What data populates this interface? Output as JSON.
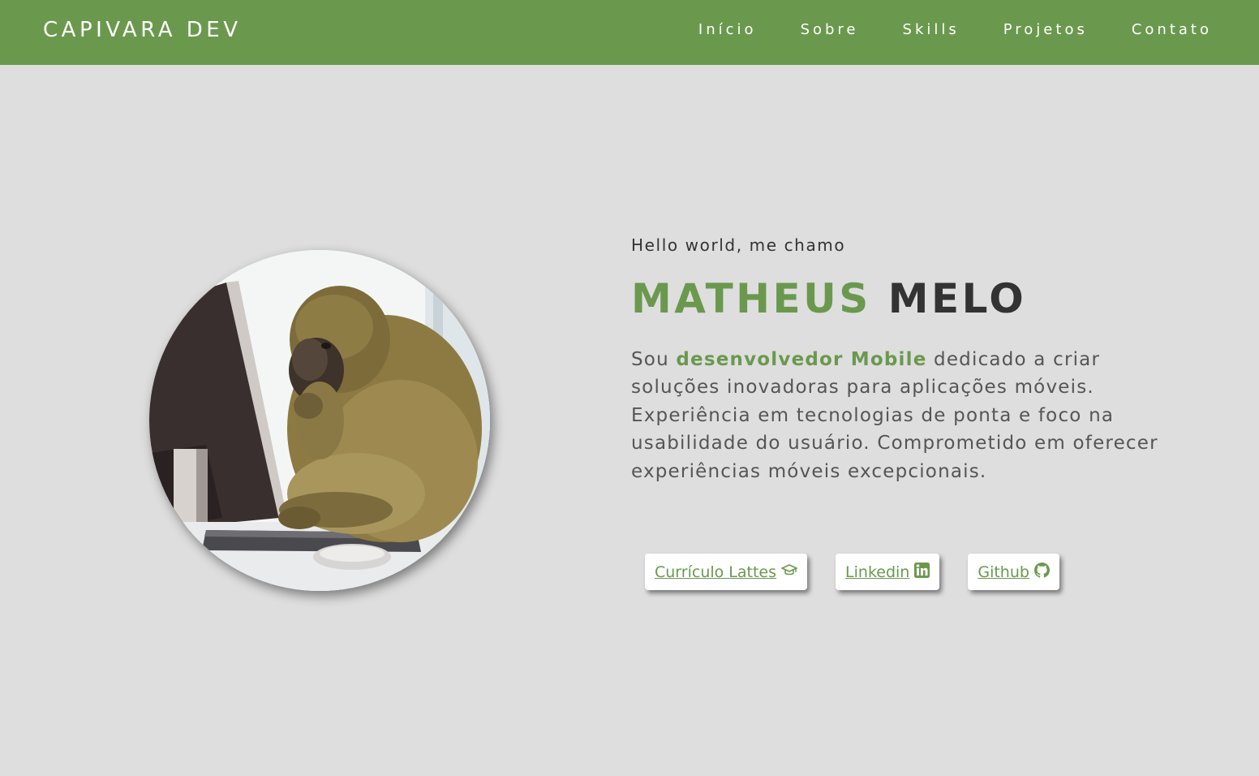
{
  "navbar": {
    "brand": "CAPIVARA DEV",
    "links": [
      {
        "label": "Início"
      },
      {
        "label": "Sobre"
      },
      {
        "label": "Skills"
      },
      {
        "label": "Projetos"
      },
      {
        "label": "Contato"
      }
    ]
  },
  "hero": {
    "greeting": "Hello world, me chamo",
    "first_name": "MATHEUS",
    "last_name": "MELO",
    "bio_prefix": "Sou ",
    "bio_highlight": "desenvolvedor Mobile",
    "bio_rest": " dedicado a criar soluções inovadoras para aplicações móveis. Experiência em tecnologias de ponta e foco na usabilidade do usuário. Comprometido em oferecer experiências móveis excepcionais.",
    "buttons": [
      {
        "label": "Currículo Lattes ",
        "icon": "graduation-cap-icon"
      },
      {
        "label": "Linkedin ",
        "icon": "linkedin-icon"
      },
      {
        "label": "Github ",
        "icon": "github-icon"
      }
    ]
  },
  "colors": {
    "accent": "#6a994e",
    "background": "#dedede",
    "dark_text": "#333333",
    "body_text": "#555555"
  }
}
